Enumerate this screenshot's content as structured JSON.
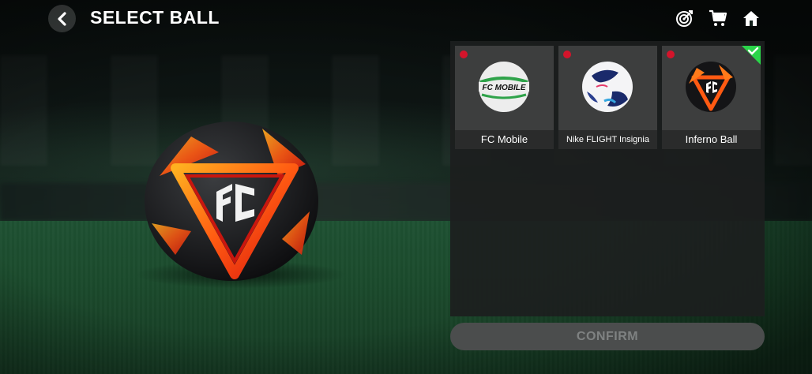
{
  "header": {
    "title": "SELECT BALL"
  },
  "top_icons": [
    "target-icon",
    "cart-icon",
    "home-icon"
  ],
  "balls": [
    {
      "name": "FC Mobile",
      "new_badge": true,
      "selected": false,
      "logo_text": "FC MOBILE"
    },
    {
      "name": "Nike FLIGHT Insignia",
      "new_badge": true,
      "selected": false
    },
    {
      "name": "Inferno Ball",
      "new_badge": true,
      "selected": true
    }
  ],
  "confirm_label": "CONFIRM",
  "colors": {
    "new_badge": "#d4142b",
    "selected_check": "#2bd44a",
    "confirm_disabled_bg": "#4b4d4d",
    "confirm_disabled_text": "#7f8282"
  }
}
